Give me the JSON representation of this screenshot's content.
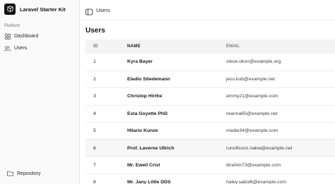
{
  "sidebar": {
    "brand": "Laravel Starter Kit",
    "group_label": "Platform",
    "items": [
      {
        "label": "Dashboard",
        "icon": "dashboard-grid-icon"
      },
      {
        "label": "Users",
        "icon": "users-icon"
      }
    ],
    "footer_items": [
      {
        "label": "Repository",
        "icon": "folder-icon"
      }
    ]
  },
  "header": {
    "breadcrumb": "Users"
  },
  "main": {
    "title": "Users",
    "table": {
      "columns": [
        "ID",
        "NAME",
        "EMAIL"
      ],
      "rows": [
        {
          "id": "1",
          "name": "Kyra Bayer",
          "email": "steve.okon@example.org"
        },
        {
          "id": "2",
          "name": "Eladio Stiedemann",
          "email": "jess.kub@example.net"
        },
        {
          "id": "3",
          "name": "Christop Hirthe",
          "email": "emmy21@example.com"
        },
        {
          "id": "4",
          "name": "Esta Goyette PhD",
          "email": "reanna65@example.net"
        },
        {
          "id": "5",
          "name": "Hilario Kunze",
          "email": "madie34@example.com"
        },
        {
          "id": "6",
          "name": "Prof. Laverne Ullrich",
          "email": "runolfsson.nakia@example.net"
        },
        {
          "id": "7",
          "name": "Mr. Ewell Crist",
          "email": "ibrahim73@example.com"
        },
        {
          "id": "8",
          "name": "Mr. Jany Little DDS",
          "email": "haley.sabol6@example.com"
        }
      ]
    }
  },
  "colors": {
    "sidebar_bg": "#fafafa",
    "header_row_bg": "#f4f4f5",
    "text_primary": "#171717",
    "logo_bg": "#111111"
  }
}
